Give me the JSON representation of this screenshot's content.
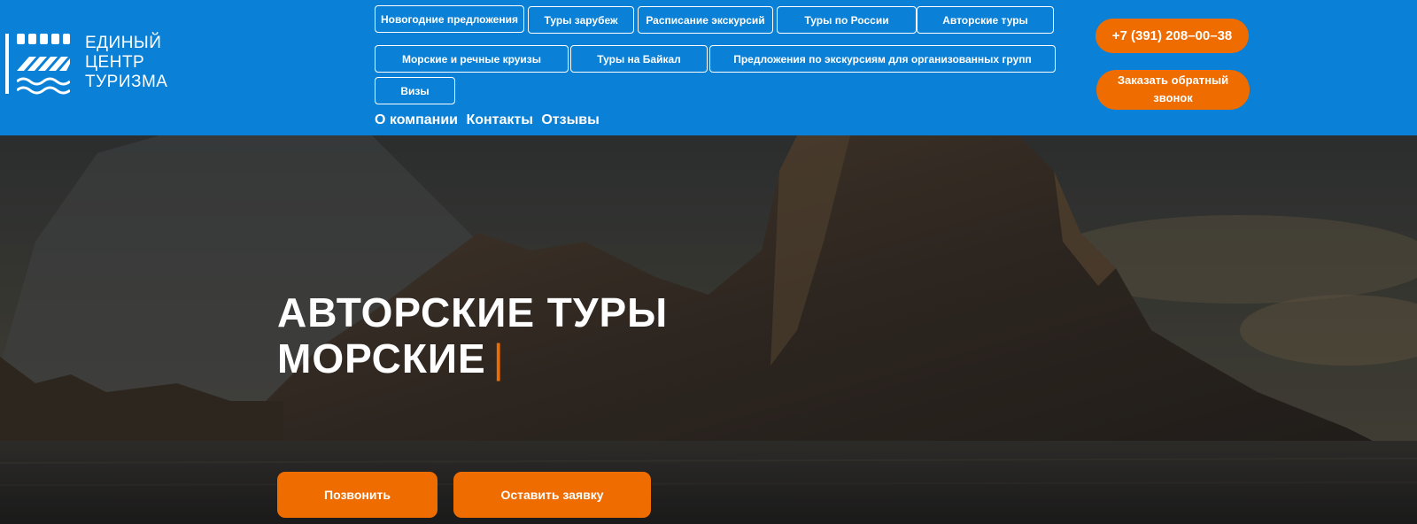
{
  "logo": {
    "lines": [
      "ЕДИНЫЙ",
      "ЦЕНТР",
      "ТУРИЗМА"
    ]
  },
  "nav": {
    "row1": [
      "Новогодние предложения",
      "Туры зарубеж",
      "Расписание экскурсий",
      "Туры по России",
      "Авторские туры"
    ],
    "row2": [
      "Морские и речные круизы",
      "Туры на Байкал",
      "Предложения по экскурсиям для организованных групп"
    ],
    "row3": [
      "Визы"
    ],
    "links": [
      "О компании",
      "Контакты",
      "Отзывы"
    ]
  },
  "contact": {
    "phone": "+7 (391) 208–00–38",
    "callback": "Заказать обратный звонок"
  },
  "hero": {
    "line1": "АВТОРСКИЕ ТУРЫ",
    "line2": "МОРСКИЕ",
    "cursor": "|",
    "call_button": "Позвонить",
    "request_button": "Оставить заявку"
  },
  "colors": {
    "header_blue": "#0a80d6",
    "accent_orange": "#ef6c00"
  }
}
